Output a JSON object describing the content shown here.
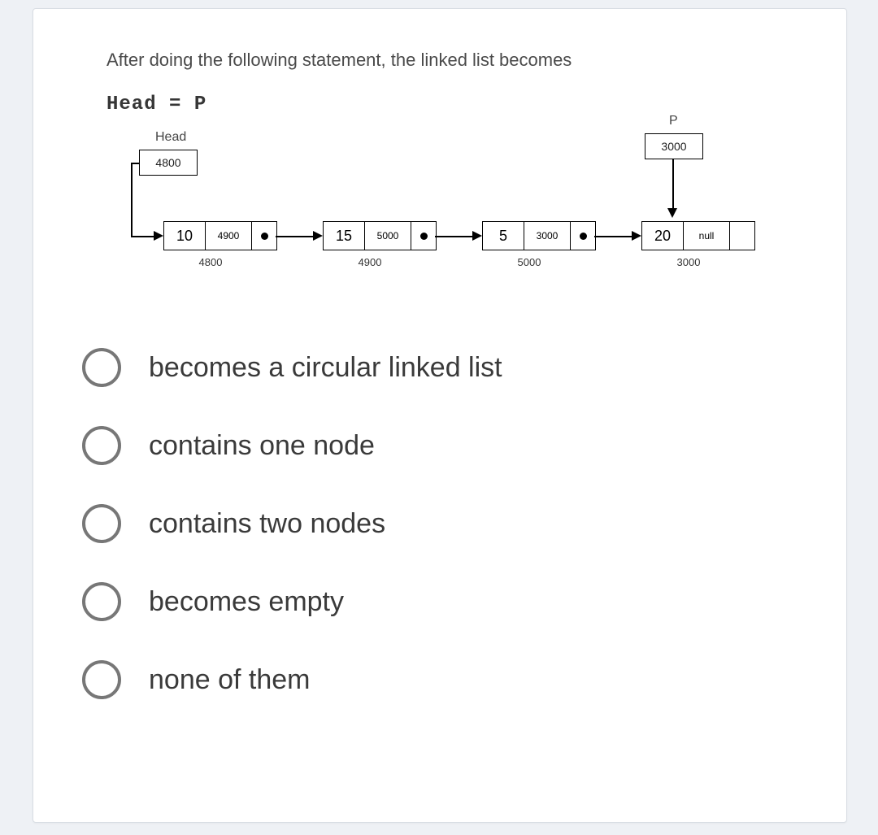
{
  "question": {
    "prompt": "After doing the following statement, the linked list becomes",
    "code": "Head = P"
  },
  "diagram": {
    "head_label": "Head",
    "head_box": "4800",
    "p_label": "P",
    "p_box": "3000",
    "nodes": [
      {
        "value": "10",
        "pointer": "4900",
        "address": "4800",
        "nullTerm": false
      },
      {
        "value": "15",
        "pointer": "5000",
        "address": "4900",
        "nullTerm": false
      },
      {
        "value": "5",
        "pointer": "3000",
        "address": "5000",
        "nullTerm": false
      },
      {
        "value": "20",
        "pointer": "null",
        "address": "3000",
        "nullTerm": true
      }
    ]
  },
  "options": [
    {
      "label": "becomes a circular linked list"
    },
    {
      "label": "contains one node"
    },
    {
      "label": "contains two nodes"
    },
    {
      "label": "becomes empty"
    },
    {
      "label": "none of them"
    }
  ]
}
